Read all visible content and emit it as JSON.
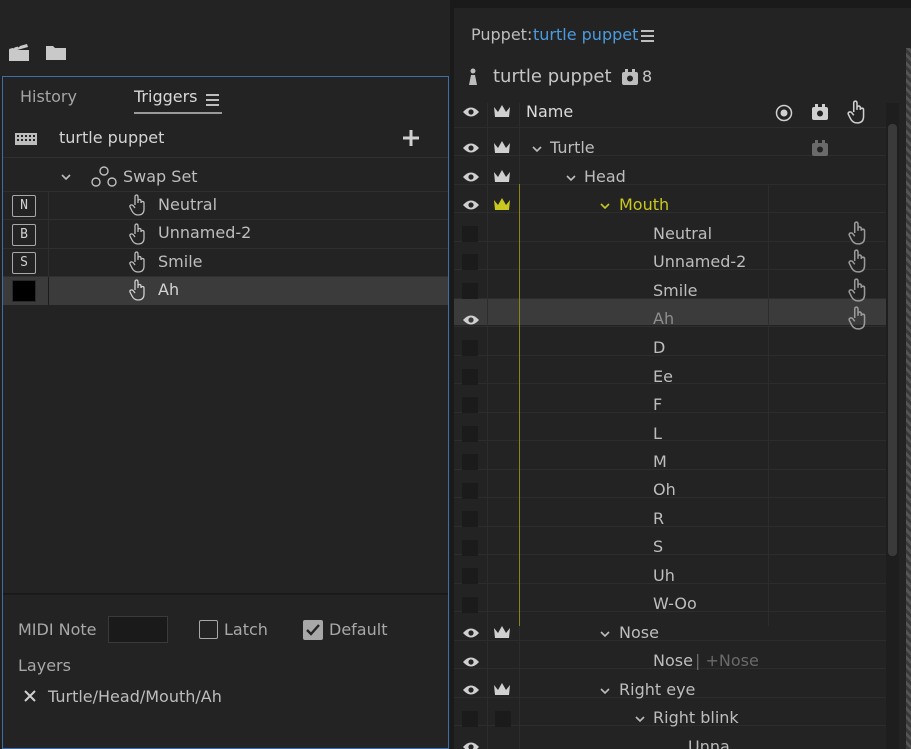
{
  "left_toolbar": {
    "icons": [
      "clapperboard-icon",
      "folder-icon"
    ]
  },
  "tabs": {
    "history": "History",
    "triggers": "Triggers"
  },
  "trigger_header": {
    "title": "turtle puppet"
  },
  "swap_set": {
    "label": "Swap Set"
  },
  "triggers": [
    {
      "key": "N",
      "label": "Neutral"
    },
    {
      "key": "B",
      "label": "Unnamed-2"
    },
    {
      "key": "S",
      "label": "Smile"
    },
    {
      "key": "",
      "label": "Ah"
    }
  ],
  "bottom": {
    "midi_label": "MIDI Note",
    "latch_label": "Latch",
    "default_label": "Default",
    "layers_label": "Layers",
    "layer_path": "Turtle/Head/Mouth/Ah"
  },
  "puppet_panel": {
    "prefix": "Puppet:",
    "name": "turtle puppet",
    "title": "turtle puppet",
    "count": "8",
    "column_name": "Name"
  },
  "tree": [
    {
      "label": "Turtle"
    },
    {
      "label": "Head"
    },
    {
      "label": "Mouth"
    },
    {
      "label": "Neutral"
    },
    {
      "label": "Unnamed-2"
    },
    {
      "label": "Smile"
    },
    {
      "label": "Ah"
    },
    {
      "label": "D"
    },
    {
      "label": "Ee"
    },
    {
      "label": "F"
    },
    {
      "label": "L"
    },
    {
      "label": "M"
    },
    {
      "label": "Oh"
    },
    {
      "label": "R"
    },
    {
      "label": "S"
    },
    {
      "label": "Uh"
    },
    {
      "label": "W-Oo"
    },
    {
      "label": "Nose"
    },
    {
      "label": "Nose",
      "suffix": "| +Nose"
    },
    {
      "label": "Right eye"
    },
    {
      "label": "Right blink"
    },
    {
      "label": "Unna..."
    }
  ],
  "colors": {
    "accent_blue": "#4b9be0",
    "yellow": "#c8c81e",
    "selection": "#3b3b3b",
    "panel_border": "#3d6ea8"
  }
}
